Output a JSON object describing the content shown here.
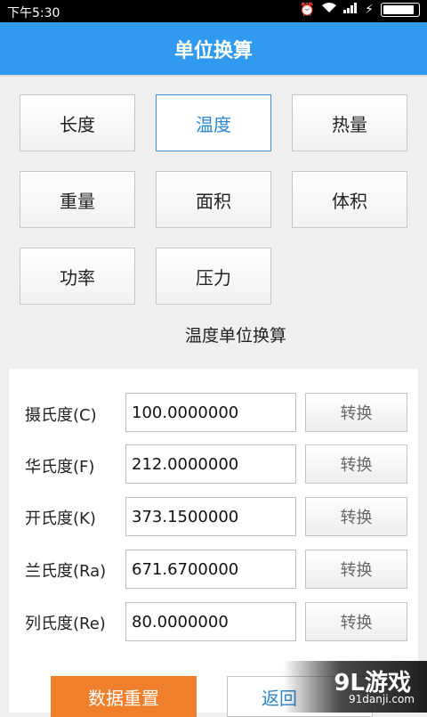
{
  "status_bar": {
    "time": "下午5:30"
  },
  "header": {
    "title": "单位换算"
  },
  "categories": [
    {
      "label": "长度"
    },
    {
      "label": "温度"
    },
    {
      "label": "热量"
    },
    {
      "label": "重量"
    },
    {
      "label": "面积"
    },
    {
      "label": "体积"
    },
    {
      "label": "功率"
    },
    {
      "label": "压力"
    }
  ],
  "active_category": "温度",
  "section_title": "温度单位换算",
  "rows": [
    {
      "label": "摄氏度(C)",
      "value": "100.0000000",
      "button": "转换"
    },
    {
      "label": "华氏度(F)",
      "value": "212.0000000",
      "button": "转换"
    },
    {
      "label": "开氏度(K)",
      "value": "373.1500000",
      "button": "转换"
    },
    {
      "label": "兰氏度(Ra)",
      "value": "671.6700000",
      "button": "转换"
    },
    {
      "label": "列氏度(Re)",
      "value": "80.0000000",
      "button": "转换"
    }
  ],
  "footer": {
    "reset_label": "数据重置",
    "back_label": "返回"
  },
  "watermark": {
    "main": "9L游戏",
    "sub": "91danji.com"
  },
  "colors": {
    "header": "#2f9af0",
    "accent": "#2b88d0",
    "reset": "#f07f2c"
  }
}
